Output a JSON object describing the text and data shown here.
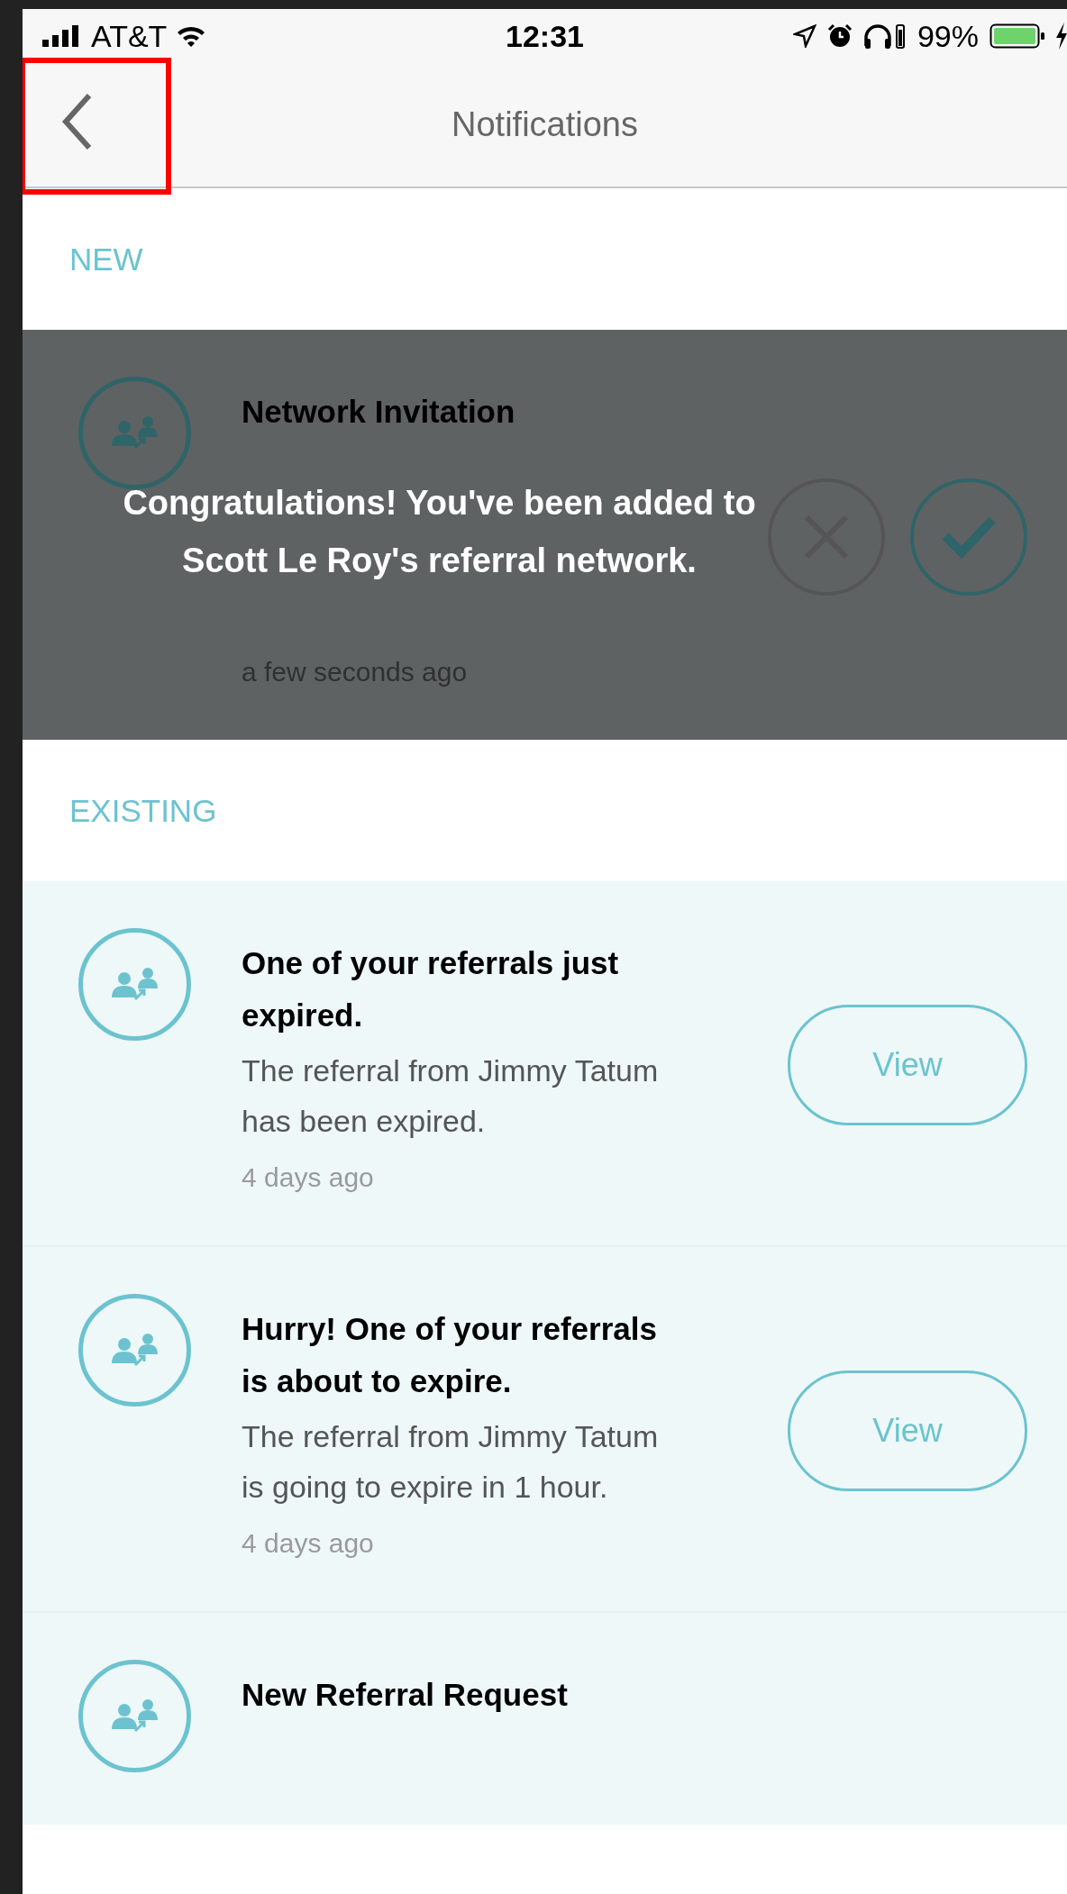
{
  "status_bar": {
    "carrier": "AT&T",
    "time": "12:31",
    "battery": "99%"
  },
  "nav": {
    "title": "Notifications",
    "back_highlighted": true
  },
  "sections": [
    {
      "title": "NEW",
      "dimmed": true,
      "toast": "Congratulations! You've been added to Scott Le Roy's referral network.",
      "items": [
        {
          "title": "Network Invitation",
          "time": "a few seconds ago",
          "action": {
            "kind": "respond"
          }
        }
      ]
    },
    {
      "title": "EXISTING",
      "dimmed": false,
      "items": [
        {
          "title": "One of your referrals just expired.",
          "message": "The referral from Jimmy Tatum has been expired.",
          "time": "4 days ago",
          "action": {
            "kind": "view",
            "label": "View"
          }
        },
        {
          "title": "Hurry! One of your referrals is about to expire.",
          "message": "The referral from Jimmy Tatum is going to expire in 1 hour.",
          "time": "4 days ago",
          "action": {
            "kind": "view",
            "label": "View"
          }
        },
        {
          "title": "New Referral Request"
        }
      ]
    }
  ]
}
